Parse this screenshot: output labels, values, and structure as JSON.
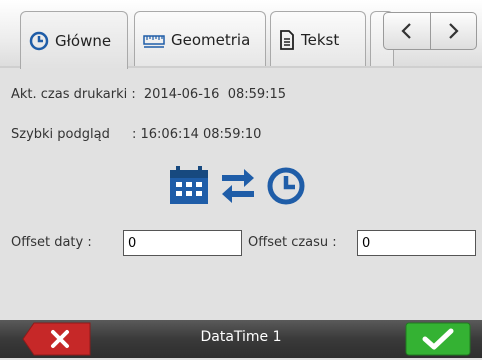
{
  "tabs": [
    {
      "label": "Główne",
      "icon": "clock-icon",
      "active": true
    },
    {
      "label": "Geometria",
      "icon": "ruler-icon",
      "active": false
    },
    {
      "label": "Tekst",
      "icon": "document-icon",
      "active": false
    }
  ],
  "nav": {
    "prev_icon": "chevron-left-icon",
    "next_icon": "chevron-right-icon"
  },
  "printer_time": {
    "label": "Akt. czas drukarki :",
    "value": "2014-06-16  08:59:15"
  },
  "quick_preview": {
    "label": "Szybki podgląd",
    "value": ": 16:06:14 08:59:10"
  },
  "action_icons": [
    "calendar-icon",
    "swap-icon",
    "clock-icon"
  ],
  "date_offset": {
    "label": "Offset daty  :",
    "value": "0"
  },
  "time_offset": {
    "label": "Offset czasu :",
    "value": "0"
  },
  "bottom": {
    "title": "DataTime 1",
    "cancel_icon": "close-icon",
    "ok_icon": "checkmark-icon"
  },
  "colors": {
    "accent_blue": "#1f5da8",
    "cancel_red": "#c62828",
    "ok_green": "#34b233",
    "background": "#e1e1e1"
  }
}
